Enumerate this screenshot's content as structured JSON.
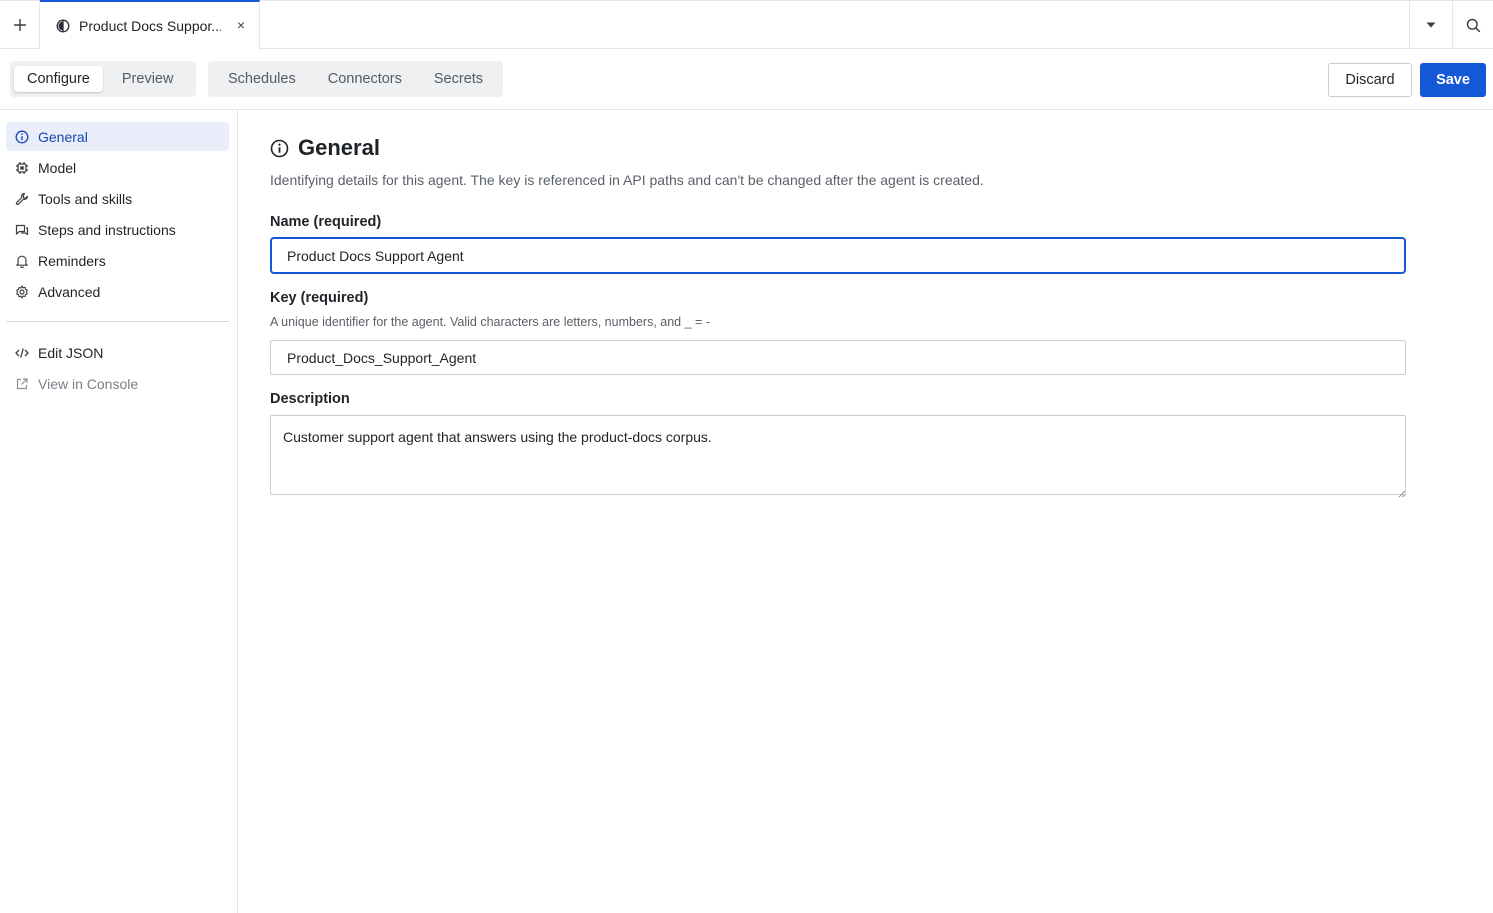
{
  "tabs": {
    "add_icon": "plus-icon",
    "active_tab": {
      "label": "Product Docs Suppor...",
      "icon": "agent-icon",
      "close_glyph": "×"
    },
    "dropdown_icon": "caret-down-icon",
    "search_icon": "search-icon"
  },
  "toolbar": {
    "mode_tabs": [
      {
        "label": "Configure",
        "active": true
      },
      {
        "label": "Preview",
        "active": false
      }
    ],
    "section_tabs": [
      {
        "label": "Schedules"
      },
      {
        "label": "Connectors"
      },
      {
        "label": "Secrets"
      }
    ],
    "discard_label": "Discard",
    "save_label": "Save"
  },
  "sidebar": {
    "items": [
      {
        "label": "General",
        "icon": "info-icon",
        "active": true
      },
      {
        "label": "Model",
        "icon": "chip-icon"
      },
      {
        "label": "Tools and skills",
        "icon": "wrench-icon"
      },
      {
        "label": "Steps and instructions",
        "icon": "chat-icon"
      },
      {
        "label": "Reminders",
        "icon": "bell-icon"
      },
      {
        "label": "Advanced",
        "icon": "gear-icon"
      }
    ],
    "secondary": [
      {
        "label": "Edit JSON",
        "icon": "code-icon"
      },
      {
        "label": "View in Console",
        "icon": "external-link-icon"
      }
    ]
  },
  "main": {
    "title": "General",
    "title_icon": "info-icon",
    "description": "Identifying details for this agent. The key is referenced in API paths and can't be changed after the agent is created.",
    "name": {
      "label": "Name (required)",
      "value": "Product Docs Support Agent"
    },
    "key": {
      "label": "Key (required)",
      "help": "A unique identifier for the agent. Valid characters are letters, numbers, and _ = -",
      "value": "Product_Docs_Support_Agent"
    },
    "description_field": {
      "label": "Description",
      "value": "Customer support agent that answers using the product-docs corpus."
    }
  },
  "colors": {
    "accent": "#1558d6",
    "active_nav_bg": "#e9eefa",
    "active_nav_text": "#1646b3",
    "border": "#e3e5e8"
  }
}
